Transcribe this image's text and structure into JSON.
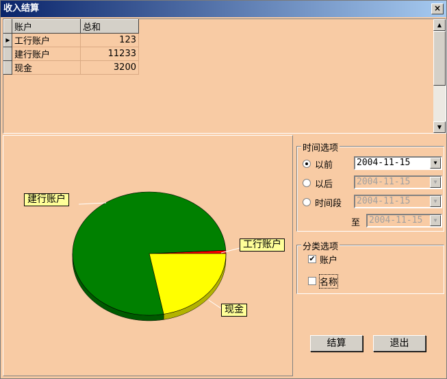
{
  "window": {
    "title": "收入结算",
    "close_label": "×"
  },
  "grid": {
    "headers": [
      "账户",
      "总和"
    ],
    "rows": [
      {
        "account": "工行账户",
        "total": "123"
      },
      {
        "account": "建行账户",
        "total": "11233"
      },
      {
        "account": "现金",
        "total": "3200"
      }
    ],
    "current_row_icon": "row-pointer-icon"
  },
  "chart_data": {
    "type": "pie",
    "slices": [
      {
        "label": "工行账户",
        "value": 123,
        "color": "#ff0000"
      },
      {
        "label": "建行账户",
        "value": 11233,
        "color": "#008000"
      },
      {
        "label": "现金",
        "value": 3200,
        "color": "#ffff00"
      }
    ],
    "legend": "none"
  },
  "time_options": {
    "title": "时间选项",
    "before": {
      "label": "以前",
      "value": "2004-11-15",
      "selected": true
    },
    "after": {
      "label": "以后",
      "value": "2004-11-15",
      "selected": false
    },
    "period": {
      "label": "时间段",
      "value": "2004-11-15",
      "selected": false
    },
    "to": {
      "label": "至",
      "value": "2004-11-15"
    }
  },
  "category_options": {
    "title": "分类选项",
    "account": {
      "label": "账户",
      "checked": true
    },
    "name": {
      "label": "名称",
      "checked": false
    }
  },
  "buttons": {
    "settle": "结算",
    "exit": "退出"
  },
  "colors": {
    "background": "#f8cba4",
    "title_start": "#0a246a",
    "title_end": "#a6caf0"
  }
}
